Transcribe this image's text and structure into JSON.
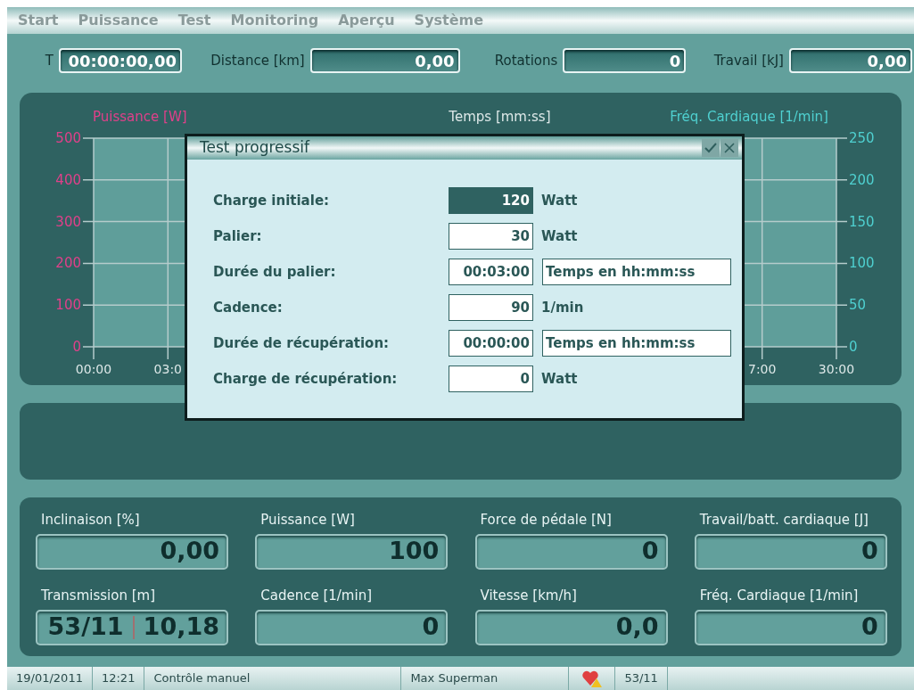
{
  "menu": [
    {
      "label": "Start"
    },
    {
      "label": "Puissance"
    },
    {
      "label": "Test"
    },
    {
      "label": "Monitoring"
    },
    {
      "label": "Aperçu"
    },
    {
      "label": "Système"
    }
  ],
  "top_fields": [
    {
      "label": "T",
      "value": "00:00:00,00"
    },
    {
      "label": "Distance [km]",
      "value": "0,00"
    },
    {
      "label": "Rotations",
      "value": "0"
    },
    {
      "label": "Travail [kJ]",
      "value": "0,00"
    }
  ],
  "chart": {
    "left_axis_title": "Puissance [W]",
    "center_title": "Temps [mm:ss]",
    "right_axis_title": "Fréq. Cardiaque [1/min]",
    "left_ticks": [
      "500",
      "400",
      "300",
      "200",
      "100",
      "0"
    ],
    "right_ticks": [
      "250",
      "200",
      "150",
      "100",
      "50",
      "0"
    ],
    "x_ticks": [
      "00:00",
      "03:0",
      "7:00",
      "30:00"
    ]
  },
  "dialog": {
    "title": "Test progressif",
    "rows": [
      {
        "label": "Charge initiale:",
        "value": "120",
        "selected": true,
        "kind": "unit",
        "unit": "Watt"
      },
      {
        "label": "Palier:",
        "value": "30",
        "selected": false,
        "kind": "unit",
        "unit": "Watt"
      },
      {
        "label": "Durée du palier:",
        "value": "00:03:00",
        "selected": false,
        "kind": "hint",
        "unit": "Temps en hh:mm:ss"
      },
      {
        "label": "Cadence:",
        "value": "90",
        "selected": false,
        "kind": "unit",
        "unit": "1/min"
      },
      {
        "label": "Durée de récupération:",
        "value": "00:00:00",
        "selected": false,
        "kind": "hint",
        "unit": "Temps en hh:mm:ss"
      },
      {
        "label": "Charge de récupération:",
        "value": "0",
        "selected": false,
        "kind": "unit",
        "unit": "Watt"
      }
    ]
  },
  "readouts": [
    {
      "label": "Inclinaison [%]",
      "values": [
        "0,00"
      ]
    },
    {
      "label": "Puissance [W]",
      "values": [
        "100"
      ]
    },
    {
      "label": "Force de pédale [N]",
      "values": [
        "0"
      ]
    },
    {
      "label": "Travail/batt. cardiaque [J]",
      "values": [
        "0"
      ]
    },
    {
      "label": "Transmission [m]",
      "values": [
        "53/11",
        "10,18"
      ]
    },
    {
      "label": "Cadence [1/min]",
      "values": [
        "0"
      ]
    },
    {
      "label": "Vitesse [km/h]",
      "values": [
        "0,0"
      ]
    },
    {
      "label": "Fréq. Cardiaque [1/min]",
      "values": [
        "0"
      ]
    }
  ],
  "status_bar": {
    "date": "19/01/2011",
    "time": "12:21",
    "mode": "Contrôle manuel",
    "user": "Max Superman",
    "gear": "53/11"
  }
}
